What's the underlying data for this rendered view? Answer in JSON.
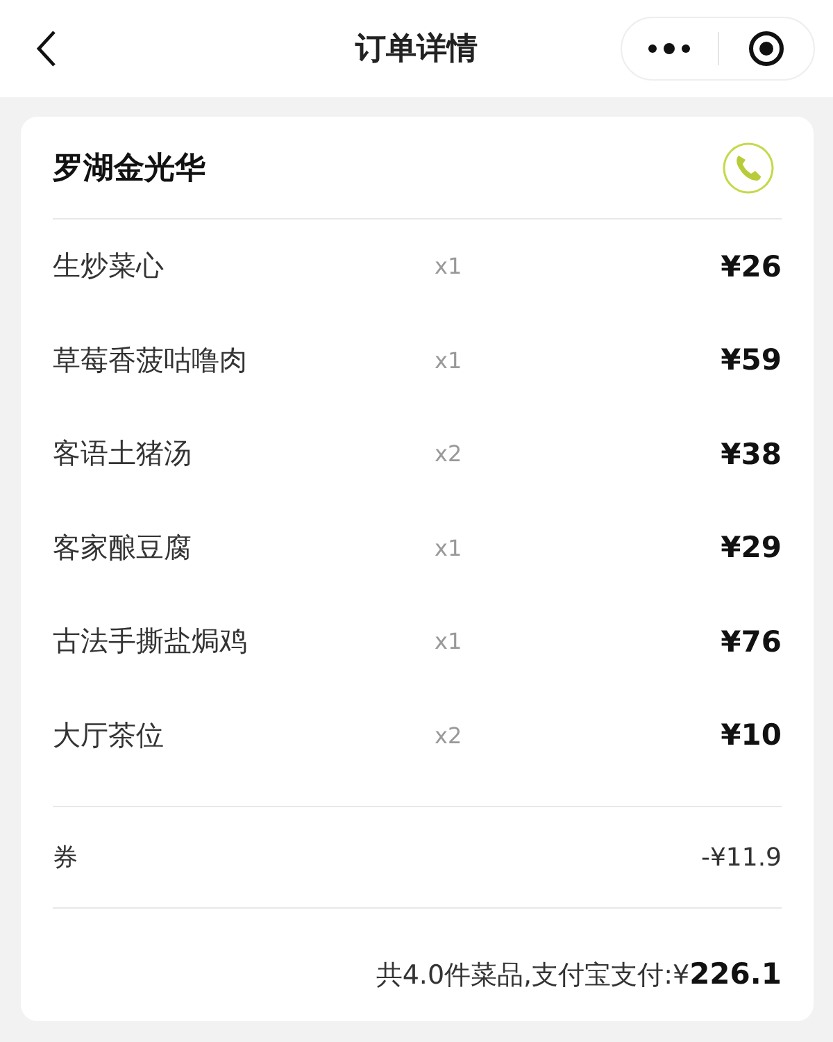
{
  "nav_bar": {
    "title": "订单详情"
  },
  "store": {
    "name": "罗湖金光华"
  },
  "items": [
    {
      "name": "生炒菜心",
      "quantity": "x1",
      "price": "¥26"
    },
    {
      "name": "草莓香菠咕噜肉",
      "quantity": "x1",
      "price": "¥59"
    },
    {
      "name": "客语土猪汤",
      "quantity": "x2",
      "price": "¥38"
    },
    {
      "name": "客家酿豆腐",
      "quantity": "x1",
      "price": "¥29"
    },
    {
      "name": "古法手撕盐焗鸡",
      "quantity": "x1",
      "price": "¥76"
    },
    {
      "name": "大厅茶位",
      "quantity": "x2",
      "price": "¥10"
    }
  ],
  "coupon": {
    "label": "券",
    "amount": "-¥11.9"
  },
  "summary": "共4.0件菜品,支付宝支付:¥**226.1**"
}
